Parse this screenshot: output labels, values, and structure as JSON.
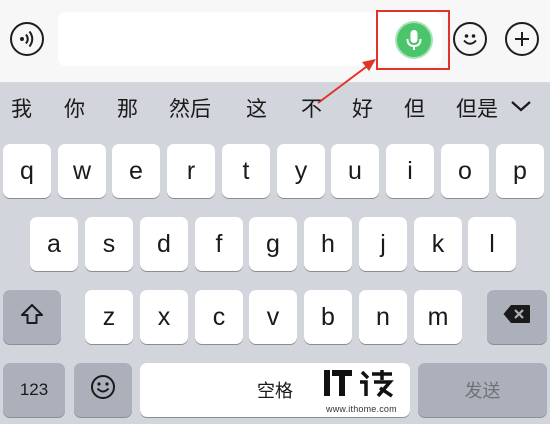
{
  "input_bar": {
    "voice_toggle_icon": "voice-wave-icon",
    "text_value": "",
    "mic_icon": "microphone-icon",
    "emoji_icon": "smiley-icon",
    "plus_icon": "plus-icon",
    "highlight_color": "#e0342b",
    "mic_color": "#4cc46c"
  },
  "candidates": {
    "items": [
      "我",
      "你",
      "那",
      "然后",
      "这",
      "不",
      "好",
      "但",
      "但是"
    ],
    "expand_icon": "chevron-down-icon"
  },
  "keyboard": {
    "row1": [
      "q",
      "w",
      "e",
      "r",
      "t",
      "y",
      "u",
      "i",
      "o",
      "p"
    ],
    "row2": [
      "a",
      "s",
      "d",
      "f",
      "g",
      "h",
      "j",
      "k",
      "l"
    ],
    "row3": [
      "z",
      "x",
      "c",
      "v",
      "b",
      "n",
      "m"
    ],
    "shift_icon": "shift-arrow-icon",
    "backspace_icon": "backspace-icon",
    "numbers_label": "123",
    "emoji_icon": "smiley-icon",
    "space_label": "空格",
    "send_label": "发送"
  },
  "watermark": {
    "logo": "IT之家",
    "url": "www.ithome.com"
  }
}
